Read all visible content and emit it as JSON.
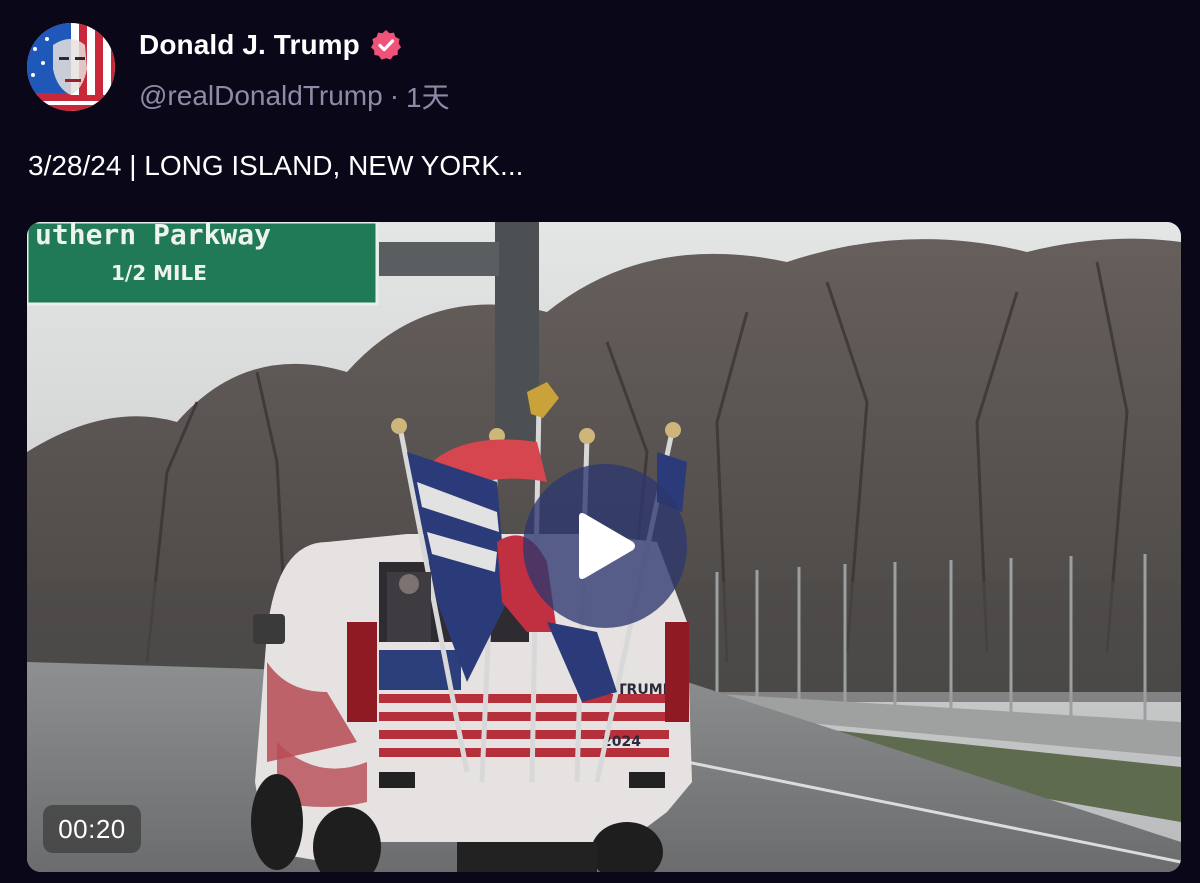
{
  "author": {
    "display_name": "Donald J. Trump",
    "handle": "@realDonaldTrump",
    "separator": "·",
    "time_ago": "1天",
    "verified_icon": "verified-badge-icon",
    "avatar_icon": "flag-portrait-avatar"
  },
  "post": {
    "text": "3/28/24 | LONG ISLAND, NEW YORK..."
  },
  "video": {
    "duration": "00:20",
    "play_icon": "play-icon",
    "sign_line1": "uthern Parkway",
    "sign_line2": "1/2  MILE",
    "plate_text": "TRUMP?",
    "year_text": "2024"
  },
  "colors": {
    "background": "#0a0718",
    "handle_gray": "#8f8aa6",
    "verified_pink": "#f0537a",
    "sign_green": "#1f7a55"
  }
}
